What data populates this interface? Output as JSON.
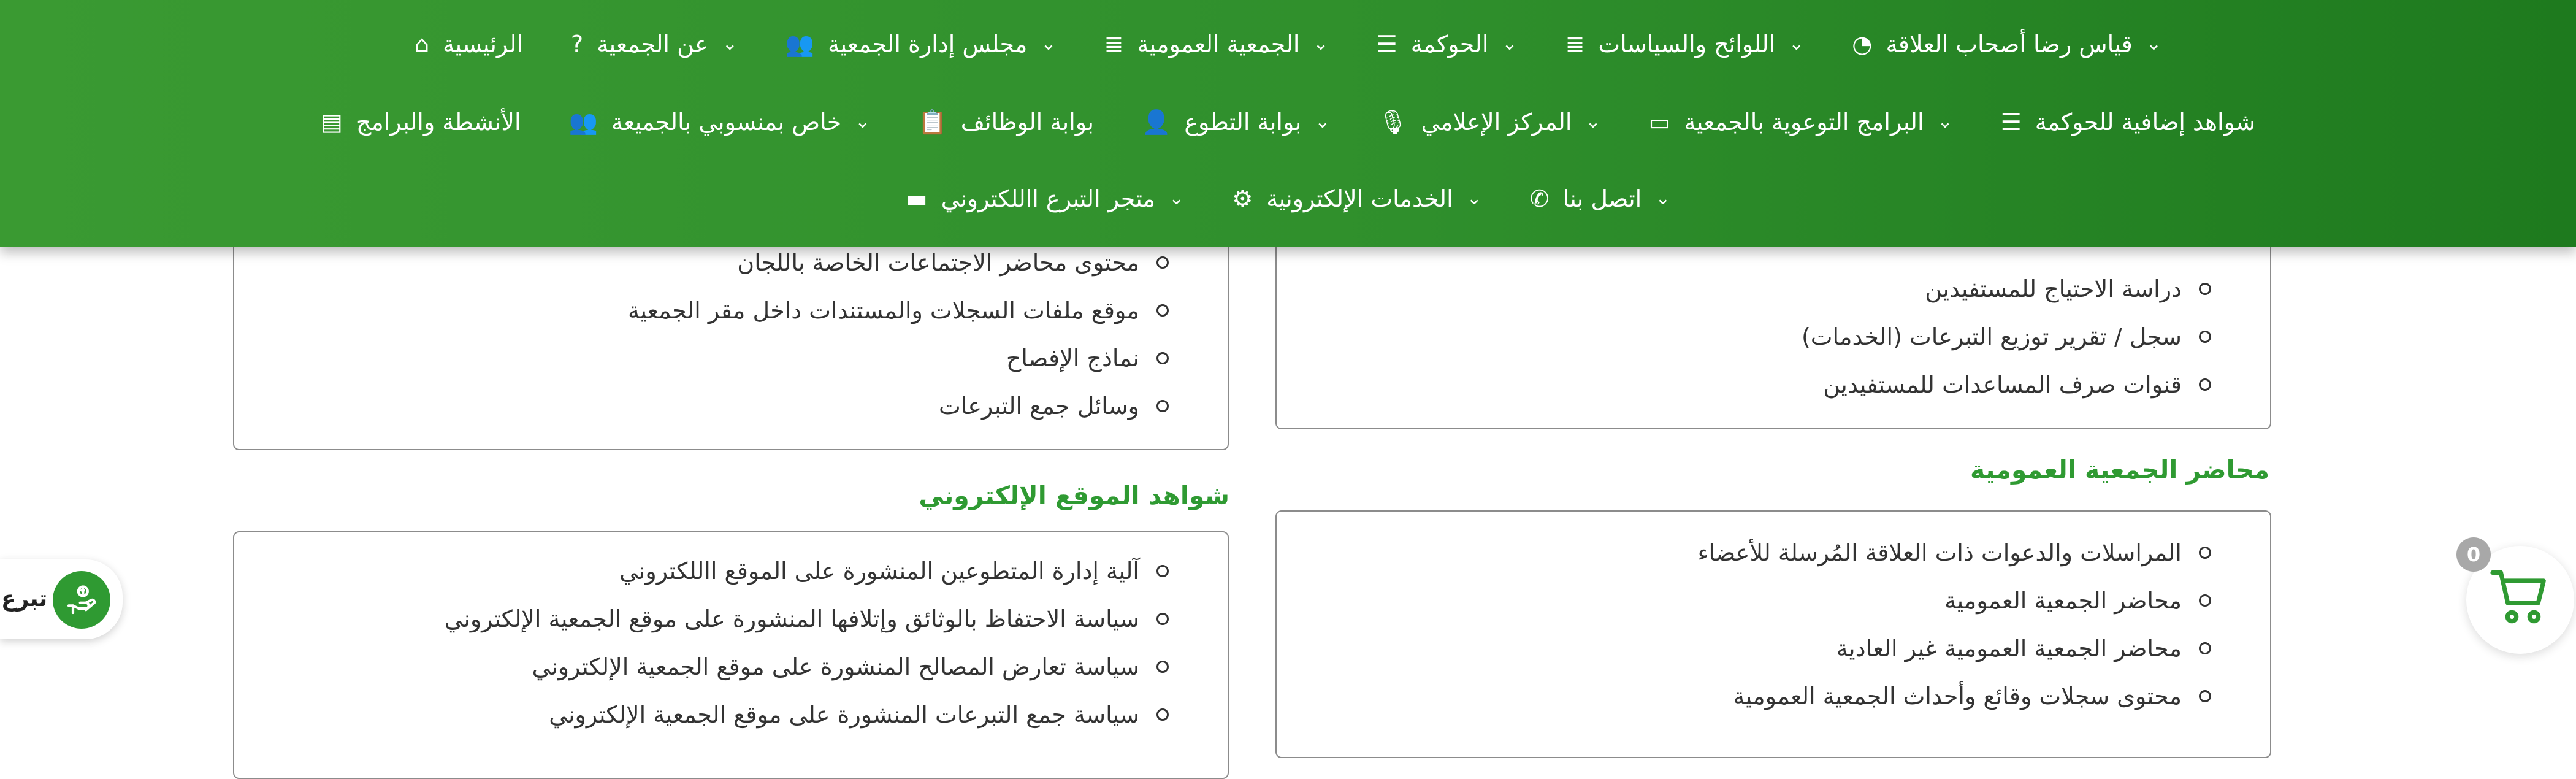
{
  "nav": {
    "row1": [
      {
        "label": "الرئيسية",
        "icon": "home-icon",
        "glyph": "⌂",
        "chevron": false
      },
      {
        "label": "عن الجمعية",
        "icon": "question-icon",
        "glyph": "?",
        "chevron": true
      },
      {
        "label": "مجلس إدارة الجمعية",
        "icon": "users-icon",
        "glyph": "👥",
        "chevron": true
      },
      {
        "label": "الجمعية العمومية",
        "icon": "list-icon",
        "glyph": "≣",
        "chevron": true
      },
      {
        "label": "الحوكمة",
        "icon": "menu-icon",
        "glyph": "☰",
        "chevron": true
      },
      {
        "label": "اللوائح والسياسات",
        "icon": "list-icon",
        "glyph": "≣",
        "chevron": true
      },
      {
        "label": "قياس رضا أصحاب العلاقة",
        "icon": "pie-chart-icon",
        "glyph": "◔",
        "chevron": true
      }
    ],
    "row2": [
      {
        "label": "الأنشطة والبرامج",
        "icon": "server-icon",
        "glyph": "▤",
        "chevron": false
      },
      {
        "label": "خاص بمنسوبي بالجميعة",
        "icon": "users-icon",
        "glyph": "👥",
        "chevron": true
      },
      {
        "label": "بوابة الوظائف",
        "icon": "clipboard-icon",
        "glyph": "📋",
        "chevron": false
      },
      {
        "label": "بوابة التطوع",
        "icon": "user-icon",
        "glyph": "👤",
        "chevron": true
      },
      {
        "label": "المركز الإعلامي",
        "icon": "microphone-icon",
        "glyph": "🎙",
        "chevron": true
      },
      {
        "label": "البرامج التوعوية بالجمعية",
        "icon": "video-icon",
        "glyph": "▭",
        "chevron": true
      },
      {
        "label": "شواهد إضافية للحوكمة",
        "icon": "align-icon",
        "glyph": "☰",
        "chevron": false
      }
    ],
    "row3": [
      {
        "label": "متجر التبرع االلكتروني",
        "icon": "credit-card-icon",
        "glyph": "▬",
        "chevron": true
      },
      {
        "label": "الخدمات الإلكترونية",
        "icon": "gears-icon",
        "glyph": "⚙",
        "chevron": true
      },
      {
        "label": "اتصل بنا",
        "icon": "phone-icon",
        "glyph": "✆",
        "chevron": true
      }
    ]
  },
  "panels": {
    "right_top": {
      "items": [
        "دراسة الاحتياج للمستفيدين",
        "سجل / تقرير توزيع التبرعات (الخدمات)",
        "قنوات صرف المساعدات للمستفيدين"
      ]
    },
    "left_top": {
      "items": [
        "محتوى محاضر الاجتماعات الخاصة باللجان",
        "موقع ملفات السجلات والمستندات داخل مقر الجمعية",
        "نماذج الإفصاح",
        "وسائل جمع التبرعات"
      ]
    },
    "right_bottom": {
      "title": "محاضر الجمعية العمومية",
      "items": [
        "المراسلات والدعوات ذات العلاقة المُرسلة للأعضاء",
        "محاضر الجمعية العمومية",
        "محاضر الجمعية العمومية غير العادية",
        "محتوى سجلات وقائع وأحداث الجمعية العمومية"
      ]
    },
    "left_bottom": {
      "title": "شواهد الموقع الإلكتروني",
      "items": [
        "آلية إدارة المتطوعين المنشورة على الموقع االلكتروني",
        "سياسة الاحتفاظ بالوثائق وإتلافها المنشورة على موقع الجمعية الإلكتروني",
        "سياسة تعارض المصالح المنشورة على موقع الجمعية الإلكتروني",
        "سياسة جمع التبرعات المنشورة على موقع الجمعية الإلكتروني"
      ]
    }
  },
  "donate": {
    "label": "تبرع",
    "icon": "donate-hand-icon"
  },
  "cart": {
    "count": "0",
    "icon": "cart-icon"
  },
  "colors": {
    "nav_green": "#2f8f2c",
    "title_green": "#2f9a32",
    "badge_gray": "#a8a8a8"
  }
}
